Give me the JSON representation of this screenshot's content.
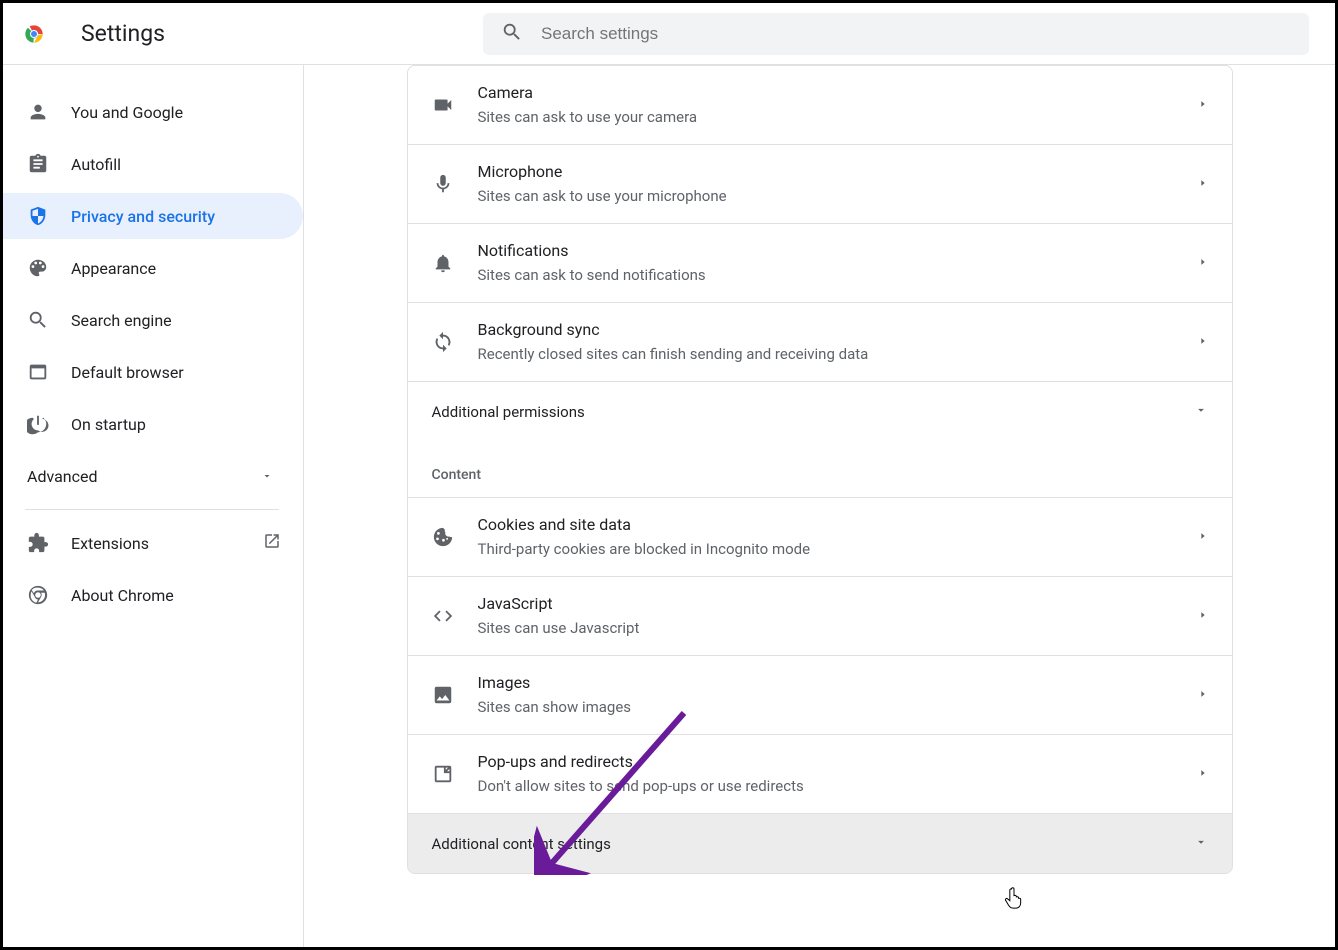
{
  "header": {
    "title": "Settings",
    "search_placeholder": "Search settings"
  },
  "sidebar": {
    "items": [
      {
        "label": "You and Google",
        "icon": "person-icon"
      },
      {
        "label": "Autofill",
        "icon": "clipboard-icon"
      },
      {
        "label": "Privacy and security",
        "icon": "shield-icon",
        "active": true
      },
      {
        "label": "Appearance",
        "icon": "palette-icon"
      },
      {
        "label": "Search engine",
        "icon": "search-icon"
      },
      {
        "label": "Default browser",
        "icon": "window-icon"
      },
      {
        "label": "On startup",
        "icon": "power-icon"
      }
    ],
    "advanced_label": "Advanced",
    "extensions_label": "Extensions",
    "about_label": "About Chrome"
  },
  "main": {
    "permissions": [
      {
        "id": "camera",
        "title": "Camera",
        "sub": "Sites can ask to use your camera",
        "icon": "camera-icon"
      },
      {
        "id": "microphone",
        "title": "Microphone",
        "sub": "Sites can ask to use your microphone",
        "icon": "mic-icon"
      },
      {
        "id": "notifications",
        "title": "Notifications",
        "sub": "Sites can ask to send notifications",
        "icon": "bell-icon"
      },
      {
        "id": "backgroundsync",
        "title": "Background sync",
        "sub": "Recently closed sites can finish sending and receiving data",
        "icon": "sync-icon"
      }
    ],
    "additional_permissions_label": "Additional permissions",
    "content_section_label": "Content",
    "content": [
      {
        "id": "cookies",
        "title": "Cookies and site data",
        "sub": "Third-party cookies are blocked in Incognito mode",
        "icon": "cookie-icon"
      },
      {
        "id": "javascript",
        "title": "JavaScript",
        "sub": "Sites can use Javascript",
        "icon": "code-icon"
      },
      {
        "id": "images",
        "title": "Images",
        "sub": "Sites can show images",
        "icon": "image-icon"
      },
      {
        "id": "popups",
        "title": "Pop-ups and redirects",
        "sub": "Don't allow sites to send pop-ups or use redirects",
        "icon": "popup-icon"
      }
    ],
    "additional_content_label": "Additional content settings"
  },
  "annotation": {
    "arrow_color": "#6a1b9a"
  }
}
